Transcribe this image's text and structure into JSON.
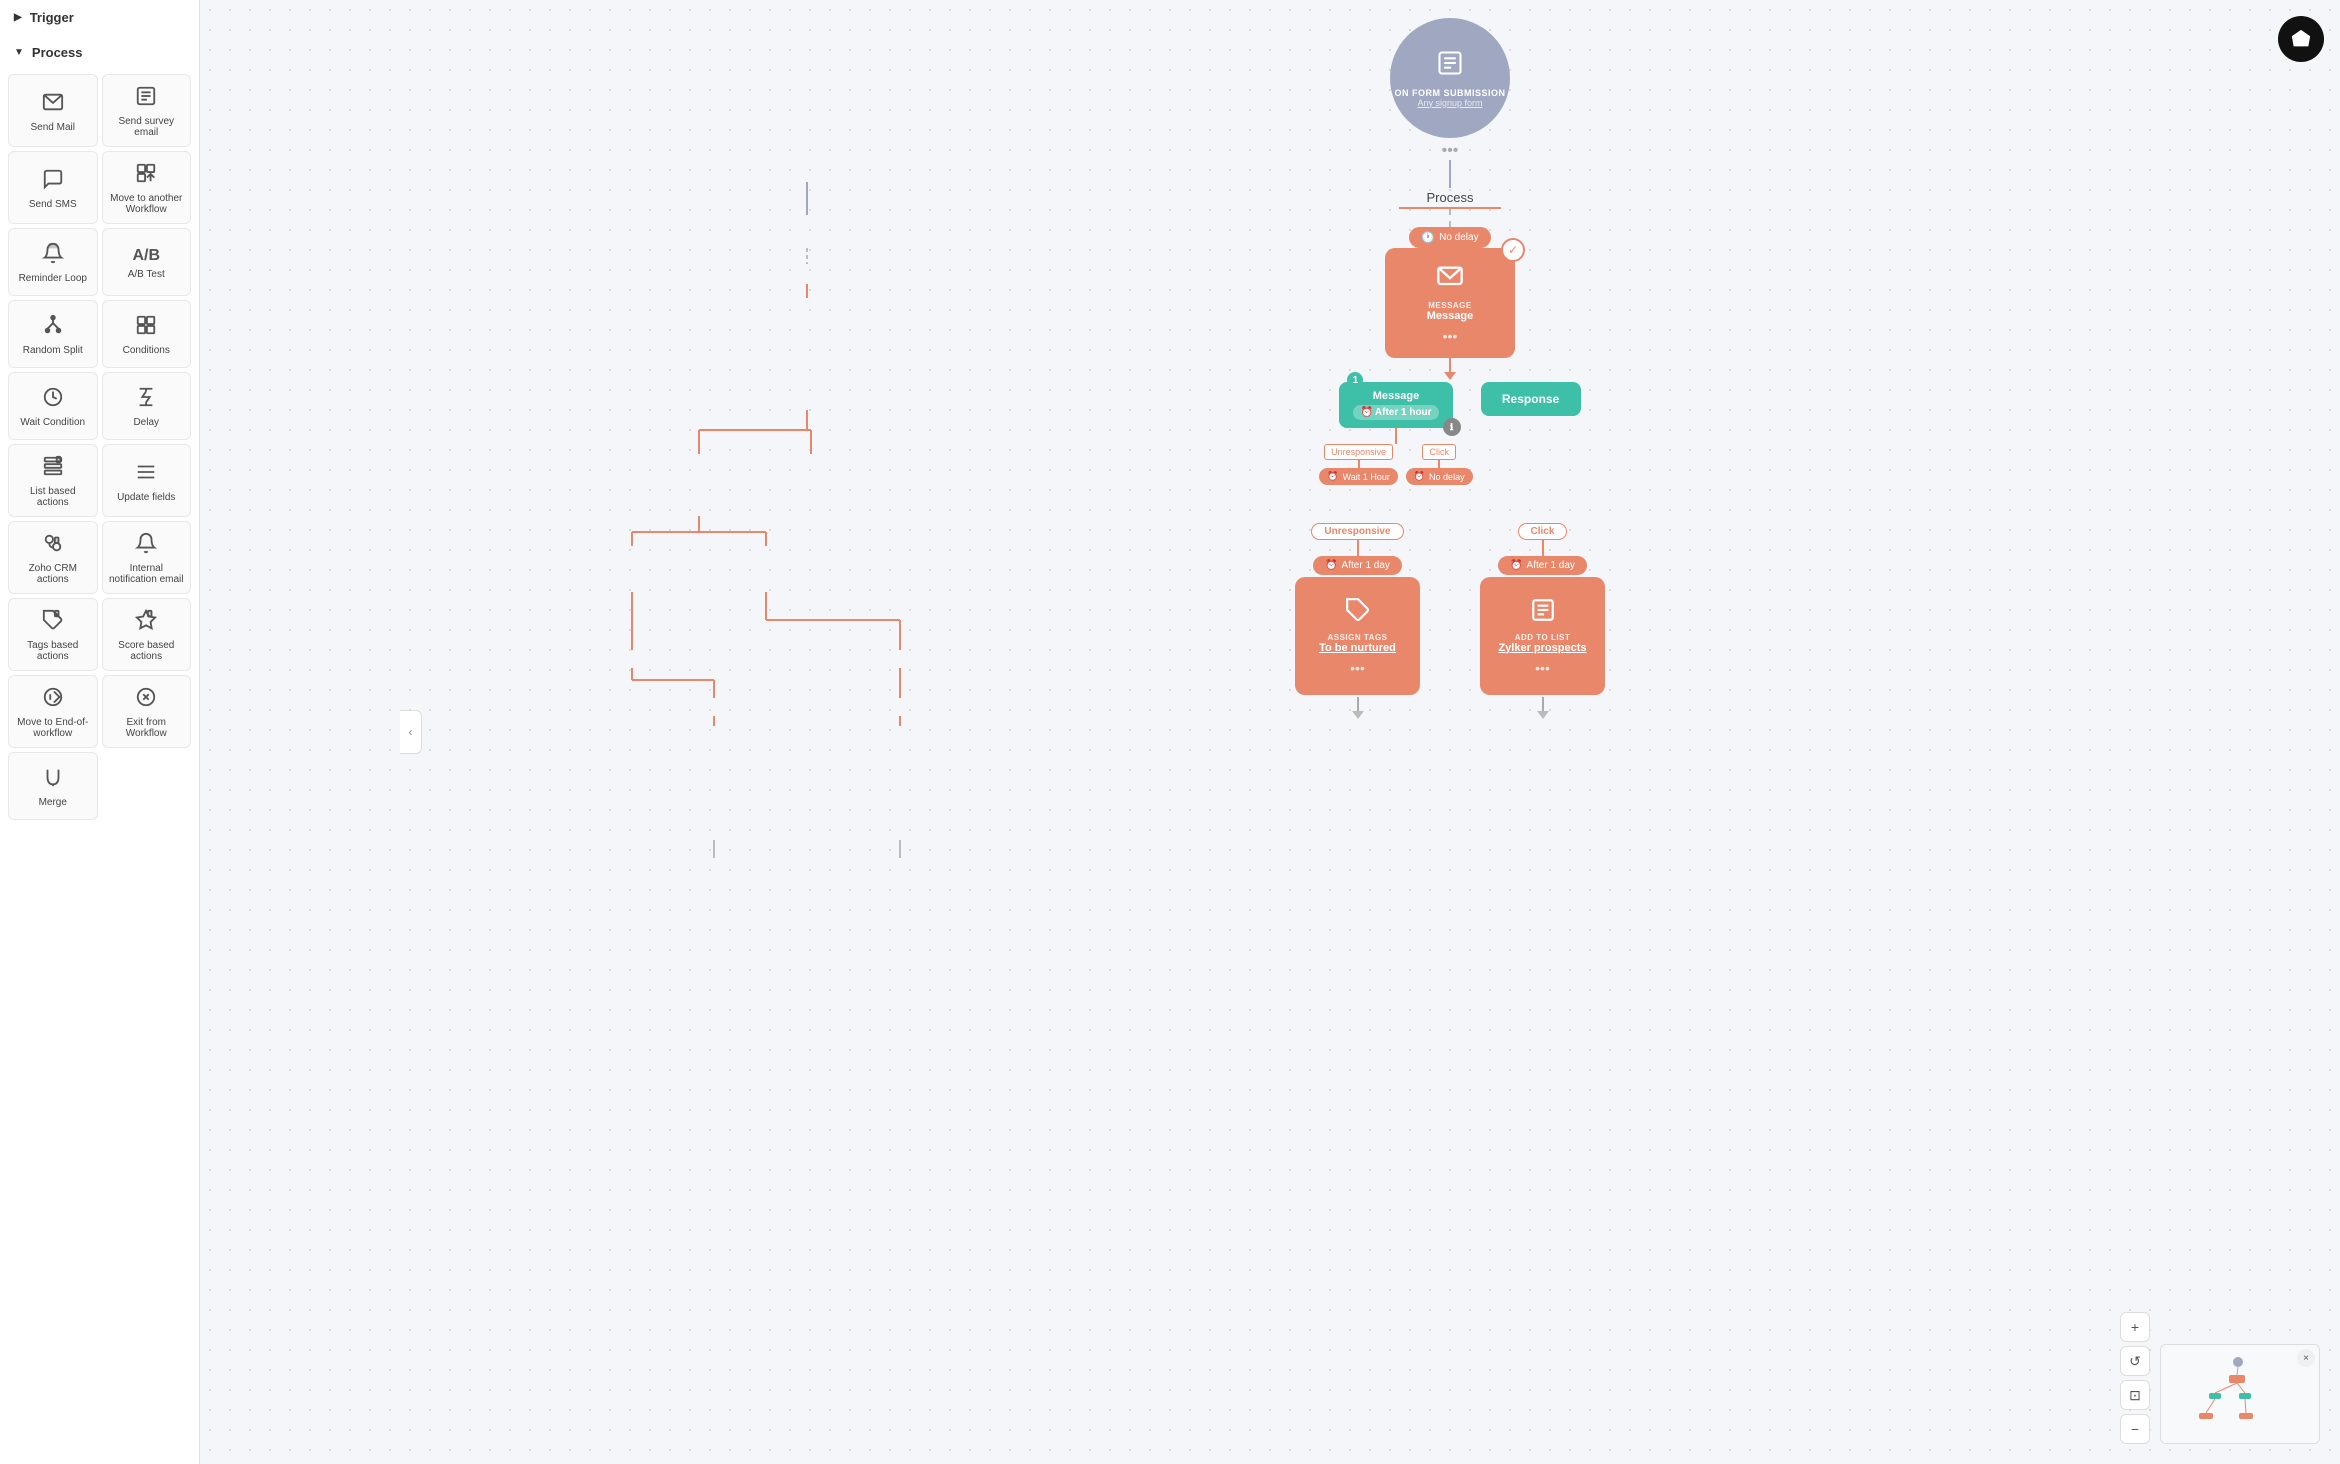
{
  "sidebar": {
    "trigger_label": "Trigger",
    "process_label": "Process",
    "items": [
      {
        "id": "send-mail",
        "label": "Send Mail",
        "icon": "✉"
      },
      {
        "id": "send-survey-email",
        "label": "Send survey email",
        "icon": "📋"
      },
      {
        "id": "send-sms",
        "label": "Send SMS",
        "icon": "💬"
      },
      {
        "id": "move-to-workflow",
        "label": "Move to another Workflow",
        "icon": "↗"
      },
      {
        "id": "reminder-loop",
        "label": "Reminder Loop",
        "icon": "🔔"
      },
      {
        "id": "ab-test",
        "label": "A/B Test",
        "icon": "A/B"
      },
      {
        "id": "random-split",
        "label": "Random Split",
        "icon": "⑂"
      },
      {
        "id": "conditions",
        "label": "Conditions",
        "icon": "⊞"
      },
      {
        "id": "wait-condition",
        "label": "Wait Condition",
        "icon": "⏱"
      },
      {
        "id": "delay",
        "label": "Delay",
        "icon": "⌛"
      },
      {
        "id": "list-based-actions",
        "label": "List based actions",
        "icon": "📄"
      },
      {
        "id": "update-fields",
        "label": "Update fields",
        "icon": "≡"
      },
      {
        "id": "zoho-crm-actions",
        "label": "Zoho CRM actions",
        "icon": "🤝"
      },
      {
        "id": "internal-notification",
        "label": "Internal notification email",
        "icon": "🔔"
      },
      {
        "id": "tags-based-actions",
        "label": "Tags based actions",
        "icon": "🏷"
      },
      {
        "id": "score-based-actions",
        "label": "Score based actions",
        "icon": "🏆"
      },
      {
        "id": "move-to-end-workflow",
        "label": "Move to End-of-workflow",
        "icon": "⏭"
      },
      {
        "id": "exit-from-workflow",
        "label": "Exit from Workflow",
        "icon": "✕"
      },
      {
        "id": "merge",
        "label": "Merge",
        "icon": "⑁"
      }
    ]
  },
  "canvas": {
    "trigger": {
      "type": "ON FORM SUBMISSION",
      "value": "Any signup form",
      "dots": "•••"
    },
    "process_label": "Process",
    "nodes": [
      {
        "id": "no-delay-1",
        "type": "delay",
        "label": "No delay"
      },
      {
        "id": "message-1",
        "type": "message",
        "title": "MESSAGE",
        "value": "Message",
        "dots": "•••"
      },
      {
        "id": "message-after-hour",
        "type": "branch",
        "label": "Message",
        "sub": "After 1 hour"
      },
      {
        "id": "response",
        "type": "branch-teal",
        "label": "Response"
      },
      {
        "id": "unresponsive-wait",
        "type": "wait",
        "label": "Unresponsive",
        "sub": "Wait 1 Hour"
      },
      {
        "id": "click-nodelay",
        "type": "wait",
        "label": "Click",
        "sub": "No delay"
      },
      {
        "id": "unresponsive-label",
        "type": "branch-label",
        "label": "Unresponsive"
      },
      {
        "id": "click-label",
        "type": "branch-label",
        "label": "Click"
      },
      {
        "id": "assign-tags-delay",
        "type": "delay",
        "label": "After 1 day"
      },
      {
        "id": "add-to-list-delay",
        "type": "delay",
        "label": "After 1 day"
      },
      {
        "id": "assign-tags",
        "type": "action",
        "title": "ASSIGN TAGS",
        "value": "To be nurtured",
        "dots": "•••"
      },
      {
        "id": "add-to-list",
        "type": "action",
        "title": "ADD TO LIST",
        "value": "Zylker prospects",
        "dots": "•••"
      }
    ]
  },
  "minimap": {
    "close_label": "×",
    "zoom_in_label": "+",
    "zoom_out_label": "−",
    "reset_label": "↺",
    "fit_label": "⊡"
  },
  "gem_button": "◇"
}
